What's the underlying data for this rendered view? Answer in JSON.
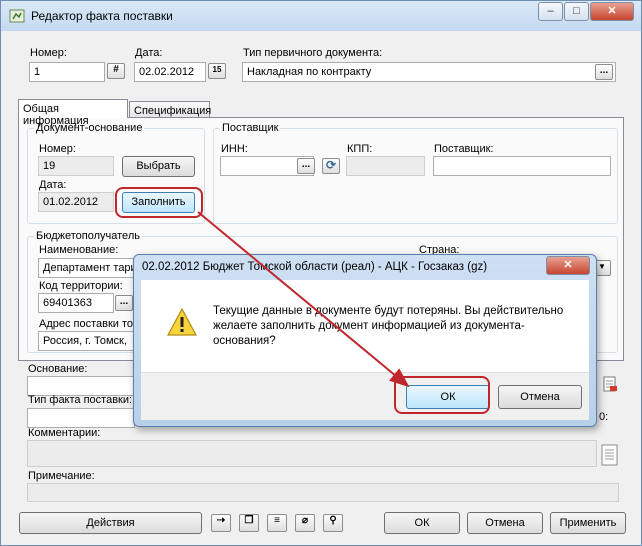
{
  "window": {
    "title": "Редактор факта поставки",
    "controls": {
      "minimize": "–",
      "maximize": "□",
      "close": "✕"
    }
  },
  "header": {
    "number_label": "Номер:",
    "number_value": "1",
    "date_label": "Дата:",
    "date_value": "02.02.2012",
    "doc_type_label": "Тип первичного документа:",
    "doc_type_value": "Накладная по контракту"
  },
  "tabs": [
    {
      "label": "Общая информация"
    },
    {
      "label": "Спецификация"
    }
  ],
  "base_document": {
    "group_title": "Документ-основание",
    "number_label": "Номер:",
    "number_value": "19",
    "select_button": "Выбрать",
    "date_label": "Дата:",
    "date_value": "01.02.2012",
    "fill_button": "Заполнить"
  },
  "supplier": {
    "group_title": "Поставщик",
    "inn_label": "ИНН:",
    "inn_value": "",
    "kpp_label": "КПП:",
    "kpp_value": "",
    "name_label": "Поставщик:",
    "name_value": ""
  },
  "recipient": {
    "group_title": "Бюджетополучатель",
    "name_label": "Наименование:",
    "name_value": "Департамент тари",
    "country_label": "Страна:",
    "territory_label": "Код территории:",
    "territory_value": "69401363",
    "address_label": "Адрес поставки тов",
    "address_value": "Россия, г. Томск, "
  },
  "basis": {
    "label": "Основание:",
    "value": ""
  },
  "delivery_type": {
    "label": "Тип факта поставки:",
    "right_value": "0:"
  },
  "comments": {
    "label": "Комментарии:",
    "value": ""
  },
  "note": {
    "label": "Примечание:",
    "value": ""
  },
  "footer": {
    "actions_button": "Действия",
    "ok_button": "ОК",
    "cancel_button": "Отмена",
    "apply_button": "Применить"
  },
  "dialog": {
    "title": "02.02.2012 Бюджет Томской области (реал) - АЦК - Госзаказ (gz)",
    "message": "Текущие данные в документе будут потеряны. Вы действительно желаете заполнить документ информацией из документа-основания?",
    "ok_button": "ОК",
    "cancel_button": "Отмена",
    "close_glyph": "✕"
  },
  "icons": {
    "ellipsis": "...",
    "number_picker": "#",
    "calendar": "15",
    "refresh": "⟳",
    "warning": "!"
  },
  "colors": {
    "highlight": "#c0272d",
    "arrow": "#c0272d",
    "dialog_frame": "#b8cfe9",
    "close_red": "#c8452e"
  }
}
